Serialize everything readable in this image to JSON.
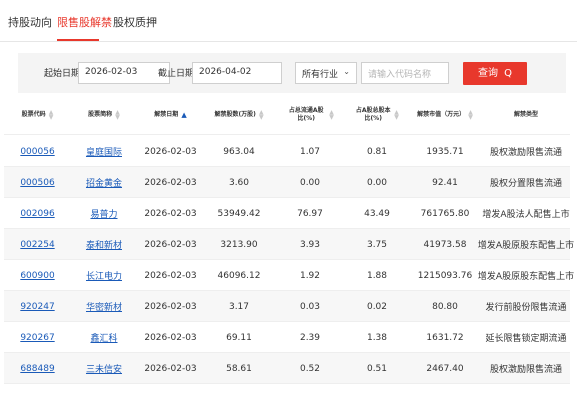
{
  "tabs": [
    {
      "label": "持股动向",
      "active": false
    },
    {
      "label": "限售股解禁",
      "active": true
    },
    {
      "label": "股权质押",
      "active": false
    }
  ],
  "filters": {
    "start_label": "起始日期：",
    "start_value": "2026-02-03",
    "end_label": "截止日期：",
    "end_value": "2026-04-02",
    "industry_value": "所有行业",
    "search_placeholder": "请输入代码名称",
    "query_label": "查询",
    "query_icon": "Q"
  },
  "table": {
    "columns": [
      {
        "label": "股票代码",
        "sort": "none"
      },
      {
        "label": "股票简称",
        "sort": "none"
      },
      {
        "label": "解禁日期",
        "sort": "asc"
      },
      {
        "label": "解禁股数(万股)",
        "sort": "none"
      },
      {
        "label": "占总流通A股比(%)",
        "sort": "none"
      },
      {
        "label": "占A股总股本比(%)",
        "sort": "none"
      },
      {
        "label": "解禁市值（万元）",
        "sort": "none"
      },
      {
        "label": "解禁类型",
        "sort": "none"
      }
    ],
    "rows": [
      [
        "000056",
        "皇庭国际",
        "2026-02-03",
        "963.04",
        "1.07",
        "0.81",
        "1935.71",
        "股权激励限售流通"
      ],
      [
        "000506",
        "招金黄金",
        "2026-02-03",
        "3.60",
        "0.00",
        "0.00",
        "92.41",
        "股权分置限售流通"
      ],
      [
        "002096",
        "易普力",
        "2026-02-03",
        "53949.42",
        "76.97",
        "43.49",
        "761765.80",
        "增发A股法人配售上市"
      ],
      [
        "002254",
        "泰和新材",
        "2026-02-03",
        "3213.90",
        "3.93",
        "3.75",
        "41973.58",
        "增发A股原股东配售上市"
      ],
      [
        "600900",
        "长江电力",
        "2026-02-03",
        "46096.12",
        "1.92",
        "1.88",
        "1215093.76",
        "增发A股原股东配售上市"
      ],
      [
        "920247",
        "华密新材",
        "2026-02-03",
        "3.17",
        "0.03",
        "0.02",
        "80.80",
        "发行前股份限售流通"
      ],
      [
        "920267",
        "鑫汇科",
        "2026-02-03",
        "69.11",
        "2.39",
        "1.38",
        "1631.72",
        "延长限售锁定期流通"
      ],
      [
        "688489",
        "三未信安",
        "2026-02-03",
        "58.61",
        "0.52",
        "0.51",
        "2467.40",
        "股权激励限售流通"
      ]
    ]
  },
  "colors": {
    "accent": "#e8382c",
    "link": "#1a5ab8"
  }
}
